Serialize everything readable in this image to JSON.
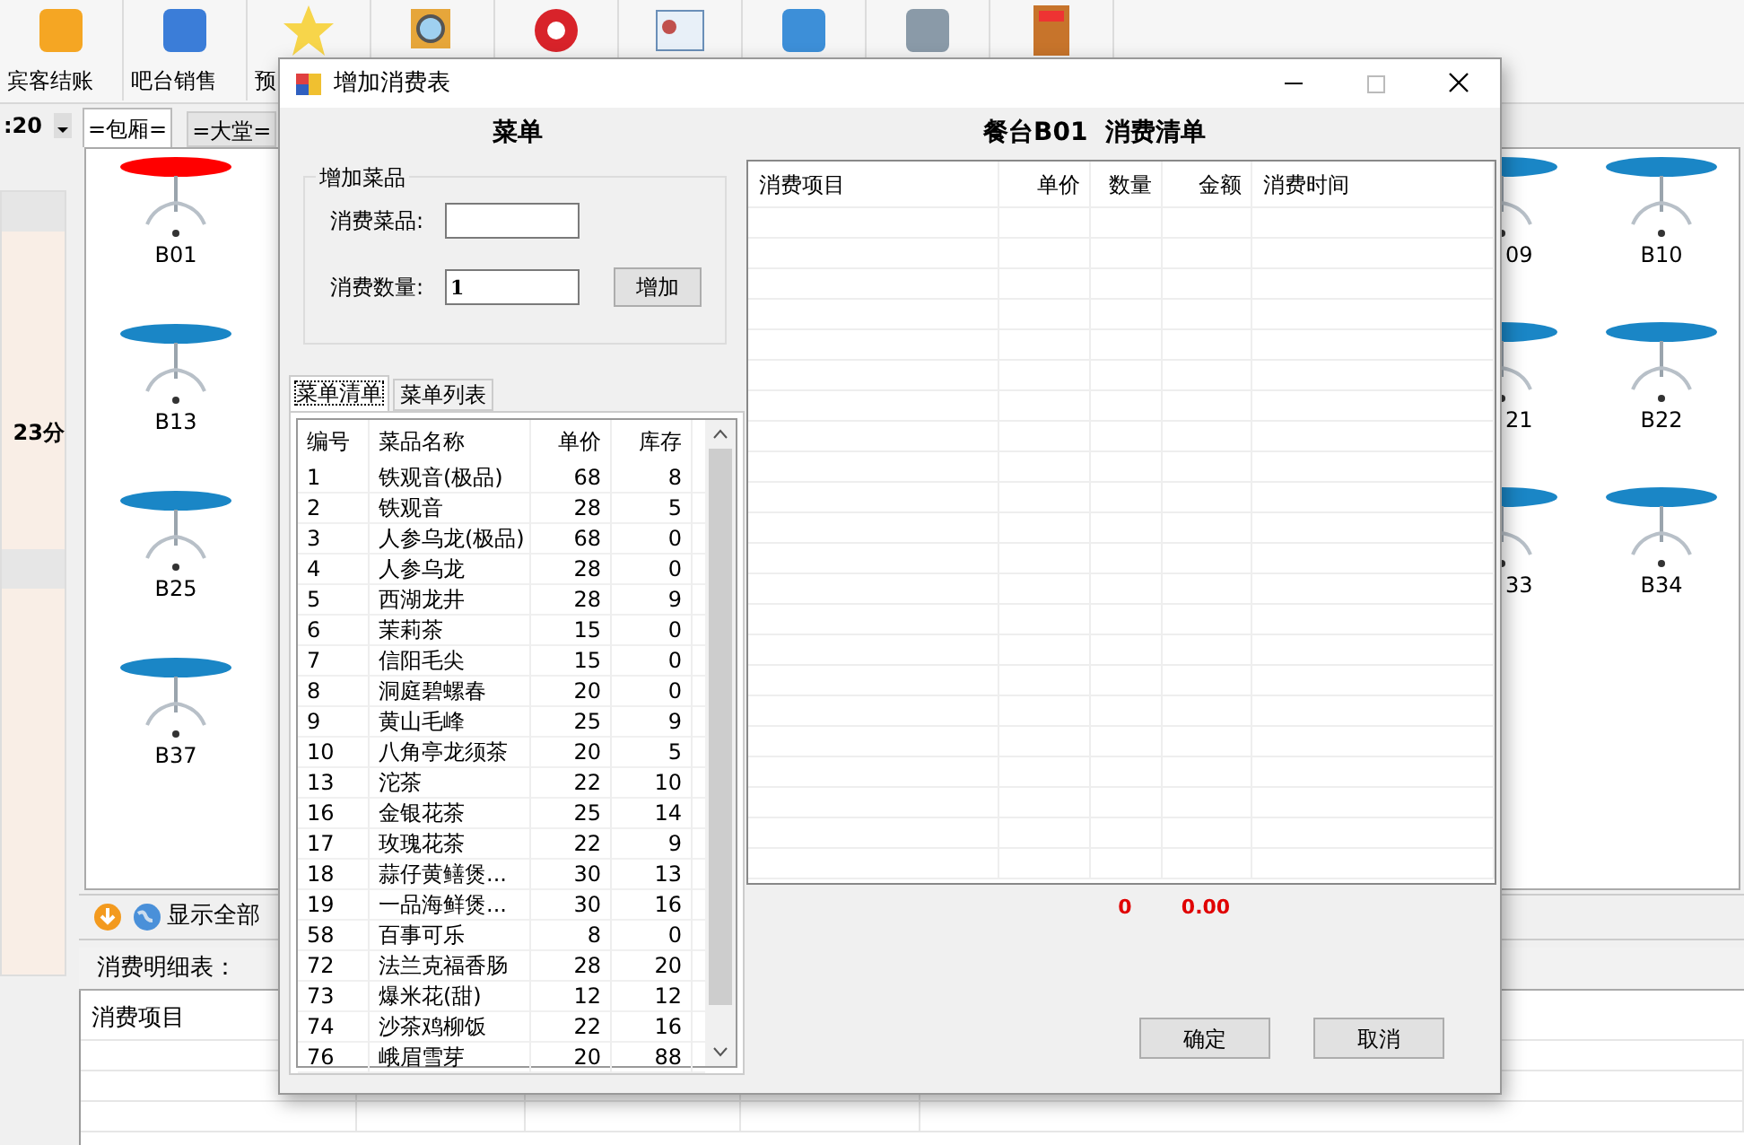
{
  "toolbar": {
    "labels": [
      "宾客结账",
      "吧台销售",
      "预"
    ]
  },
  "clock_fragment": ":20",
  "area_tabs": [
    {
      "label": "=包厢=",
      "selected": true
    },
    {
      "label": "=大堂=",
      "selected": false
    }
  ],
  "side_panel": {
    "text": "23分"
  },
  "tables_left": [
    {
      "label": "B01",
      "color": "#ff0000"
    },
    {
      "label": "B13",
      "color": "#1a86c6"
    },
    {
      "label": "B25",
      "color": "#1a86c6"
    },
    {
      "label": "B37",
      "color": "#1a86c6"
    }
  ],
  "tables_right": [
    {
      "label": "09",
      "color": "#1a86c6"
    },
    {
      "label": "B10",
      "color": "#1a86c6"
    },
    {
      "label": "21",
      "color": "#1a86c6"
    },
    {
      "label": "B22",
      "color": "#1a86c6"
    },
    {
      "label": "33",
      "color": "#1a86c6"
    },
    {
      "label": "B34",
      "color": "#1a86c6"
    }
  ],
  "bottom_toolbar": {
    "button": "显示全部"
  },
  "detail_panel": {
    "title": "消费明细表：",
    "columns": [
      "消费项目"
    ]
  },
  "dialog": {
    "title": "增加消费表",
    "menu_heading": "菜单",
    "add_group": {
      "title": "增加菜品",
      "item_label": "消费菜品:",
      "quantity_label": "消费数量:",
      "quantity": "1",
      "add_button": "增加"
    },
    "tabs": [
      {
        "label": "菜单清单",
        "selected": true
      },
      {
        "label": "菜单列表",
        "selected": false
      }
    ],
    "menu_table": {
      "columns": [
        "编号",
        "菜品名称",
        "单价",
        "库存"
      ],
      "rows": [
        [
          "1",
          "铁观音(极品)",
          "68",
          "8"
        ],
        [
          "2",
          "铁观音",
          "28",
          "5"
        ],
        [
          "3",
          "人参乌龙(极品)",
          "68",
          "0"
        ],
        [
          "4",
          "人参乌龙",
          "28",
          "0"
        ],
        [
          "5",
          "西湖龙井",
          "28",
          "9"
        ],
        [
          "6",
          "茉莉茶",
          "15",
          "0"
        ],
        [
          "7",
          "信阳毛尖",
          "15",
          "0"
        ],
        [
          "8",
          "洞庭碧螺春",
          "20",
          "0"
        ],
        [
          "9",
          "黄山毛峰",
          "25",
          "9"
        ],
        [
          "10",
          "八角亭龙须茶",
          "20",
          "5"
        ],
        [
          "13",
          "沱茶",
          "22",
          "10"
        ],
        [
          "16",
          "金银花茶",
          "25",
          "14"
        ],
        [
          "17",
          "玫瑰花茶",
          "22",
          "9"
        ],
        [
          "18",
          "蒜仔黄鳝煲...",
          "30",
          "13"
        ],
        [
          "19",
          "一品海鲜煲...",
          "30",
          "16"
        ],
        [
          "58",
          "百事可乐",
          "8",
          "0"
        ],
        [
          "72",
          "法兰克福香肠",
          "28",
          "20"
        ],
        [
          "73",
          "爆米花(甜)",
          "12",
          "12"
        ],
        [
          "74",
          "沙茶鸡柳饭",
          "22",
          "16"
        ],
        [
          "76",
          "峨眉雪芽",
          "20",
          "88"
        ]
      ]
    },
    "bill_title": "餐台B01  消费清单",
    "bill_table": {
      "columns": [
        "消费项目",
        "单价",
        "数量",
        "金额",
        "消费时间"
      ]
    },
    "totals": {
      "quantity": "0",
      "amount": "0.00"
    },
    "buttons": [
      "确定",
      "取消"
    ]
  }
}
